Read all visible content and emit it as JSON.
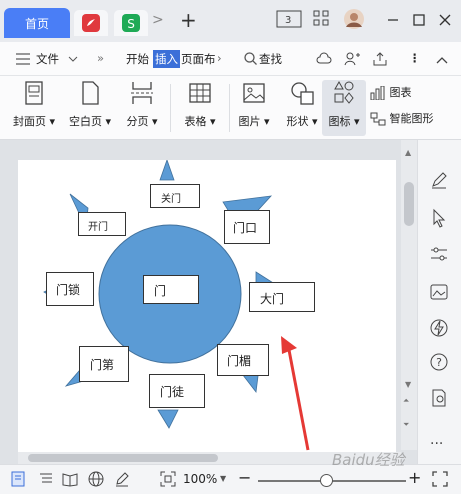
{
  "tabs": {
    "home_label": "首页",
    "new_tab_symbol": "+",
    "more_symbol": ">"
  },
  "menu": {
    "file_label": "文件",
    "start_label": "开始",
    "insert_label": "插入",
    "page_label": "页面布",
    "search_label": "查找"
  },
  "ribbon": {
    "cover": "封面页",
    "blank": "空白页",
    "section": "分页",
    "table": "表格",
    "image": "图片",
    "shape": "形状",
    "icon": "图标",
    "chart": "图表",
    "smart": "智能图形"
  },
  "diagram": {
    "center": "门",
    "labels": {
      "top": "关门",
      "top_left": "开门",
      "top_right": "门口",
      "left": "门锁",
      "right": "大门",
      "bottom_left": "门第",
      "bottom_right": "门楣",
      "bottom": "门徒"
    },
    "sun_color": "#5b9bd5"
  },
  "status": {
    "zoom": "100%",
    "minus": "−",
    "plus": "+"
  },
  "watermark": "Baidu经验"
}
